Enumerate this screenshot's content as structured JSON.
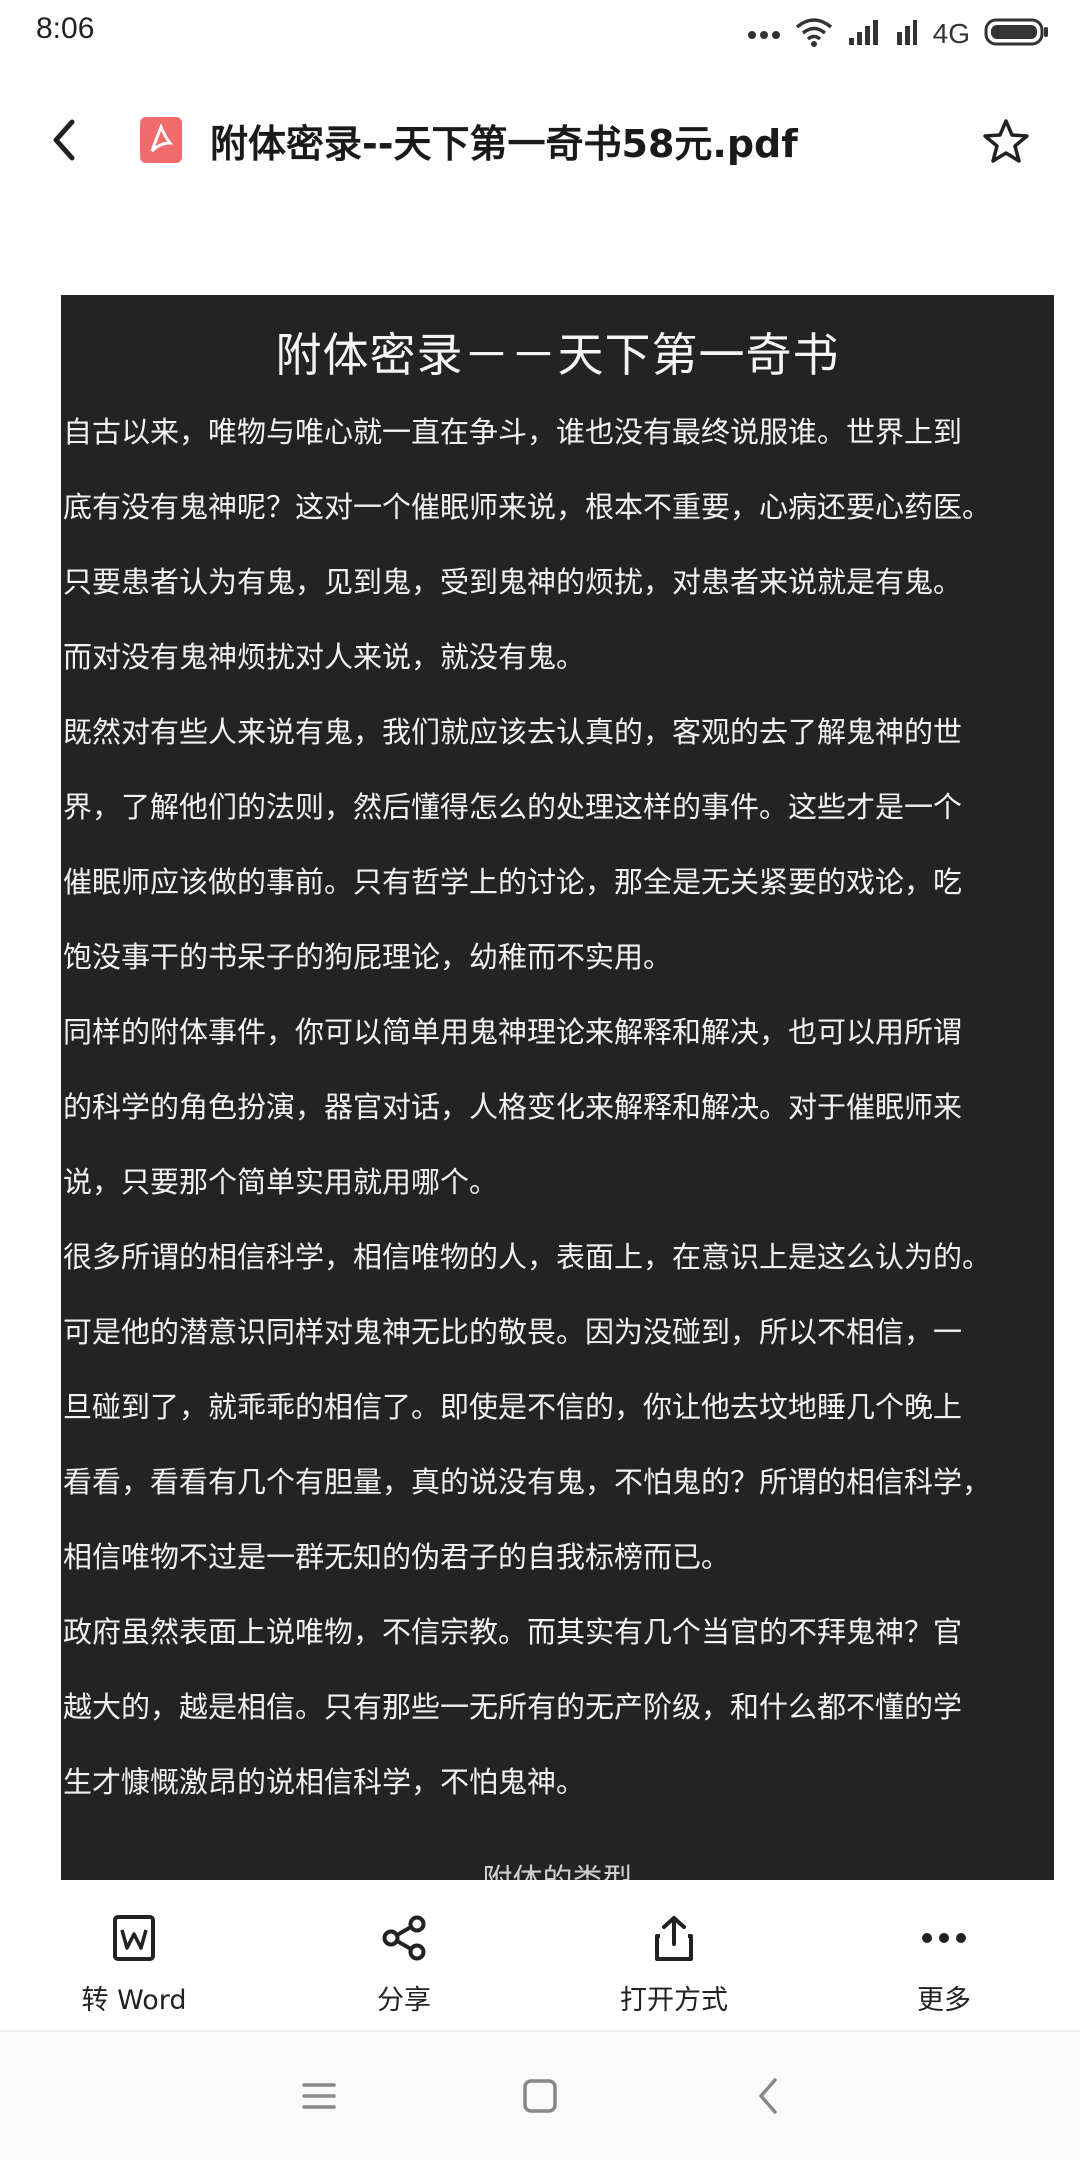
{
  "status_bar": {
    "time": "8:06",
    "network": "4G",
    "icons": [
      "more-dots-icon",
      "wifi-icon",
      "signal-icon",
      "signal-2-icon",
      "battery-icon"
    ]
  },
  "header": {
    "file_title": "附体密录--天下第一奇书58元.pdf",
    "back_icon": "back-chevron-icon",
    "file_icon": "pdf-file-icon",
    "favorite_icon": "star-icon"
  },
  "document": {
    "heading": "附体密录－－天下第一奇书",
    "lines": [
      "自古以来，唯物与唯心就一直在争斗，谁也没有最终说服谁。世界上到",
      "底有没有鬼神呢？这对一个催眠师来说，根本不重要，心病还要心药医。",
      "只要患者认为有鬼，见到鬼，受到鬼神的烦扰，对患者来说就是有鬼。",
      "而对没有鬼神烦扰对人来说，就没有鬼。",
      "既然对有些人来说有鬼，我们就应该去认真的，客观的去了解鬼神的世",
      "界，了解他们的法则，然后懂得怎么的处理这样的事件。这些才是一个",
      "催眠师应该做的事前。只有哲学上的讨论，那全是无关紧要的戏论，吃",
      "饱没事干的书呆子的狗屁理论，幼稚而不实用。",
      "同样的附体事件，你可以简单用鬼神理论来解释和解决，也可以用所谓",
      "的科学的角色扮演，器官对话，人格变化来解释和解决。对于催眠师来",
      "说，只要那个简单实用就用哪个。",
      "很多所谓的相信科学，相信唯物的人，表面上，在意识上是这么认为的。",
      "可是他的潜意识同样对鬼神无比的敬畏。因为没碰到，所以不相信，一",
      "旦碰到了，就乖乖的相信了。即使是不信的，你让他去坟地睡几个晚上",
      "看看，看看有几个有胆量，真的说没有鬼，不怕鬼的？所谓的相信科学，",
      "相信唯物不过是一群无知的伪君子的自我标榜而已。",
      "政府虽然表面上说唯物，不信宗教。而其实有几个当官的不拜鬼神？官",
      "越大的，越是相信。只有那些一无所有的无产阶级，和什么都不懂的学",
      "生才慷慨激昂的说相信科学，不怕鬼神。"
    ],
    "next_heading_partial": "附体的类型"
  },
  "actions": {
    "to_word": "转 Word",
    "share": "分享",
    "open_with": "打开方式",
    "more": "更多"
  },
  "nav": {
    "icons": [
      "menu-icon",
      "home-square-icon",
      "back-triangle-icon"
    ]
  },
  "colors": {
    "page_background": "#232323",
    "page_text": "#f1f1f1",
    "pdf_icon": "#f06b6b"
  }
}
